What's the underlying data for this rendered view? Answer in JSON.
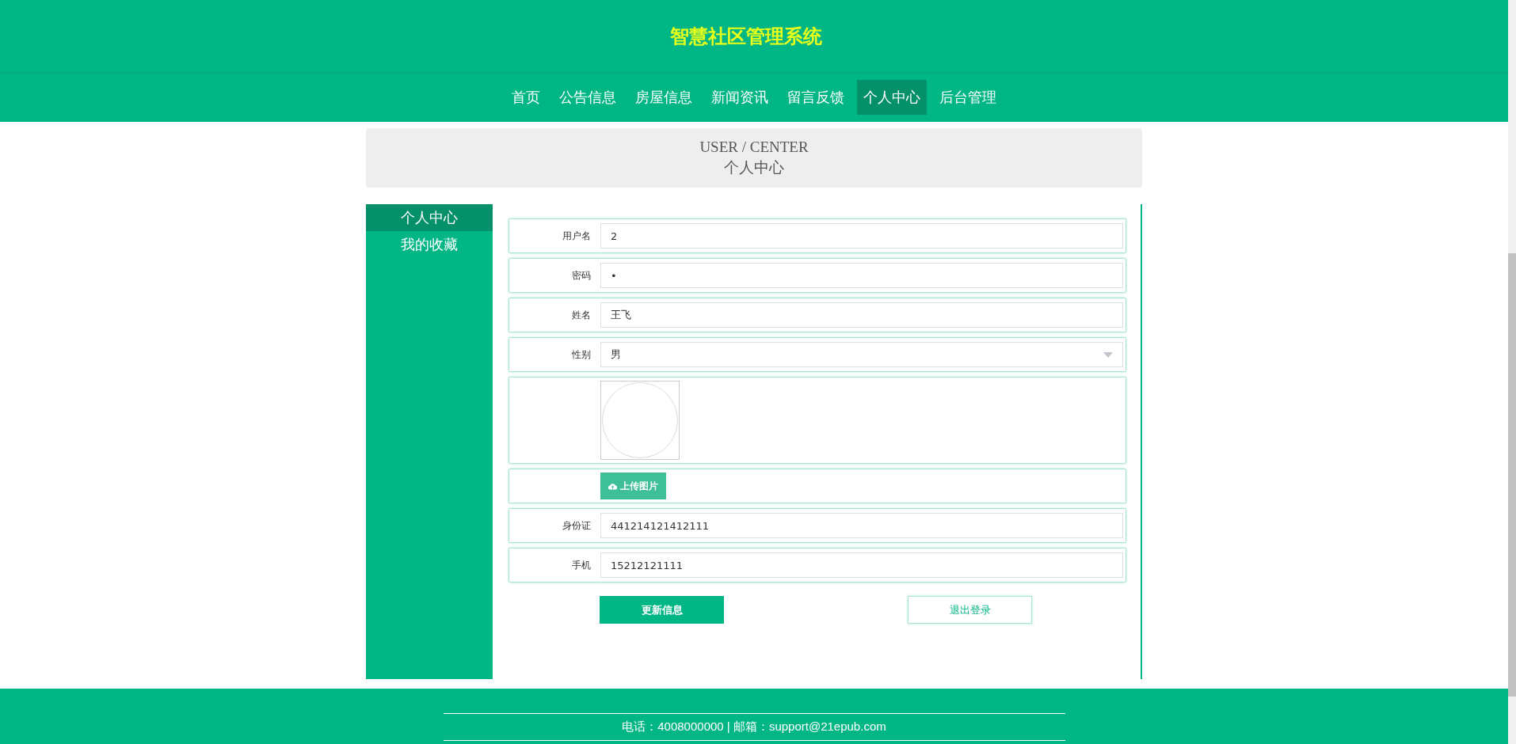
{
  "header": {
    "title": "智慧社区管理系统"
  },
  "nav": [
    {
      "label": "首页",
      "selected": false
    },
    {
      "label": "公告信息",
      "selected": false
    },
    {
      "label": "房屋信息",
      "selected": false
    },
    {
      "label": "新闻资讯",
      "selected": false
    },
    {
      "label": "留言反馈",
      "selected": false
    },
    {
      "label": "个人中心",
      "selected": true
    },
    {
      "label": "后台管理",
      "selected": false
    }
  ],
  "banner": {
    "title_en": "USER / CENTER",
    "title": "个人中心"
  },
  "sidebar": [
    {
      "label": "个人中心",
      "selected": true
    },
    {
      "label": "我的收藏",
      "selected": false
    }
  ],
  "form": {
    "fields": [
      {
        "kind": "text",
        "label": "用户名",
        "value": "2"
      },
      {
        "kind": "text",
        "label": "密码",
        "value": "•"
      },
      {
        "kind": "text",
        "label": "姓名",
        "value": "王飞"
      },
      {
        "kind": "select",
        "label": "性别",
        "value": "男"
      },
      {
        "kind": "image"
      },
      {
        "kind": "upload",
        "button": "上传图片"
      },
      {
        "kind": "text",
        "label": "身份证",
        "value": "441214121412111"
      },
      {
        "kind": "text",
        "label": "手机",
        "value": "15212121111"
      }
    ],
    "buttons": [
      {
        "kind": "primary",
        "label": "更新信息"
      },
      {
        "kind": "outline",
        "label": "退出登录"
      }
    ]
  },
  "footer": {
    "text": "电话：4008000000 | 邮箱：support@21epub.com"
  }
}
